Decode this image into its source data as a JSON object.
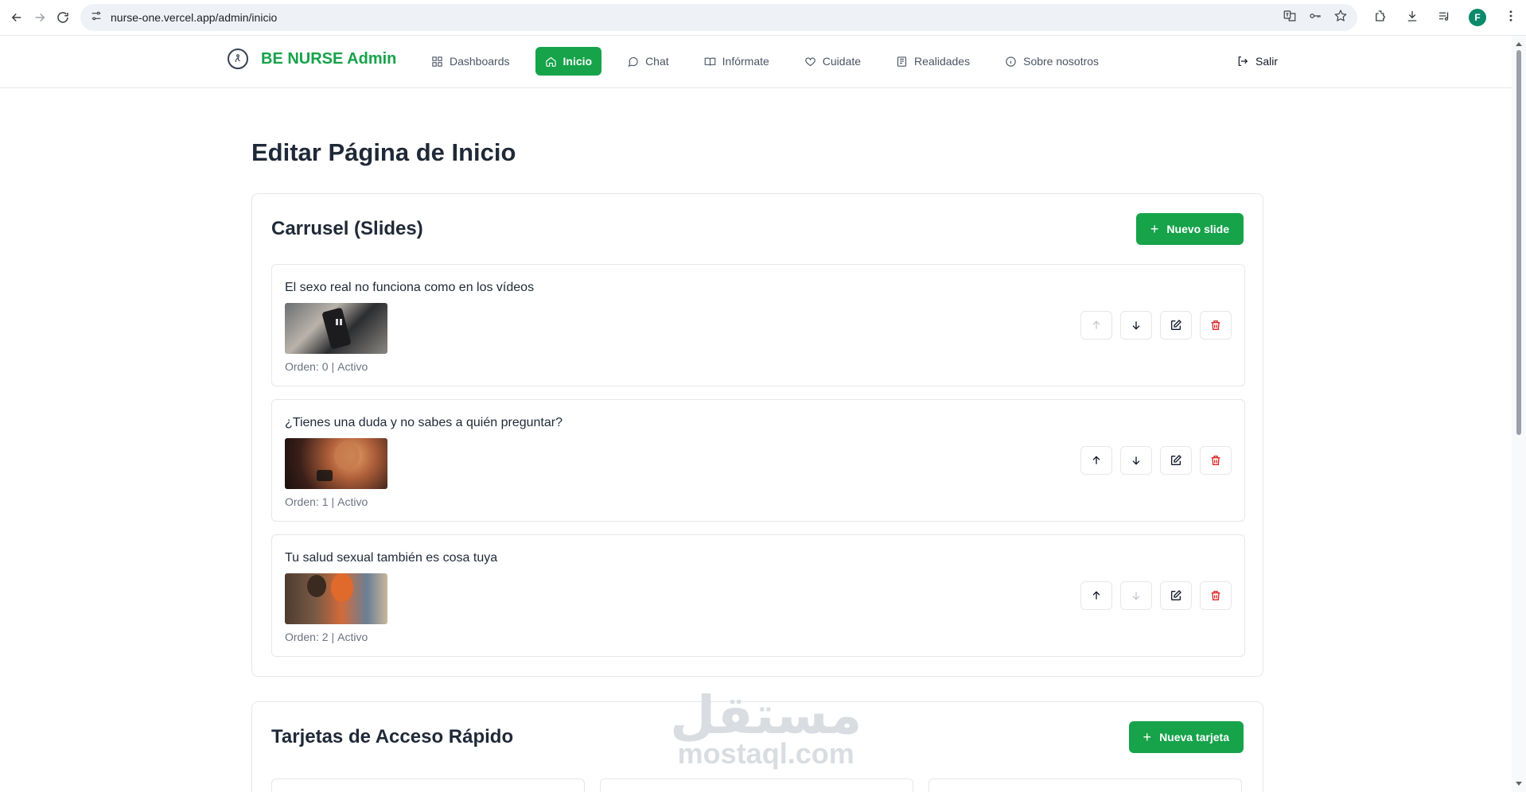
{
  "browser": {
    "url": "nurse-one.vercel.app/admin/inicio",
    "profile_initial": "F"
  },
  "header": {
    "brand": "BE NURSE Admin",
    "nav": [
      {
        "label": "Dashboards",
        "icon": "grid-icon"
      },
      {
        "label": "Inicio",
        "icon": "home-icon",
        "active": true
      },
      {
        "label": "Chat",
        "icon": "chat-icon"
      },
      {
        "label": "Infórmate",
        "icon": "book-icon"
      },
      {
        "label": "Cuidate",
        "icon": "heart-icon"
      },
      {
        "label": "Realidades",
        "icon": "newspaper-icon"
      },
      {
        "label": "Sobre nosotros",
        "icon": "info-icon"
      }
    ],
    "logout_label": "Salir"
  },
  "page": {
    "title": "Editar Página de Inicio"
  },
  "carrusel": {
    "title": "Carrusel (Slides)",
    "new_button": "Nuevo slide",
    "slides": [
      {
        "title": "El sexo real no funciona como en los vídeos",
        "orden": "Orden: 0",
        "estado": "Activo"
      },
      {
        "title": "¿Tienes una duda y no sabes a quién preguntar?",
        "orden": "Orden: 1",
        "estado": "Activo"
      },
      {
        "title": "Tu salud sexual también es cosa tuya",
        "orden": "Orden: 2",
        "estado": "Activo"
      }
    ]
  },
  "tarjetas": {
    "title": "Tarjetas de Acceso Rápido",
    "new_button": "Nueva tarjeta"
  },
  "watermark": {
    "arabic": "مستقل",
    "latin": "mostaql.com"
  },
  "colors": {
    "primary": "#16a34a",
    "danger": "#dc2626",
    "border": "#e5e7eb"
  }
}
